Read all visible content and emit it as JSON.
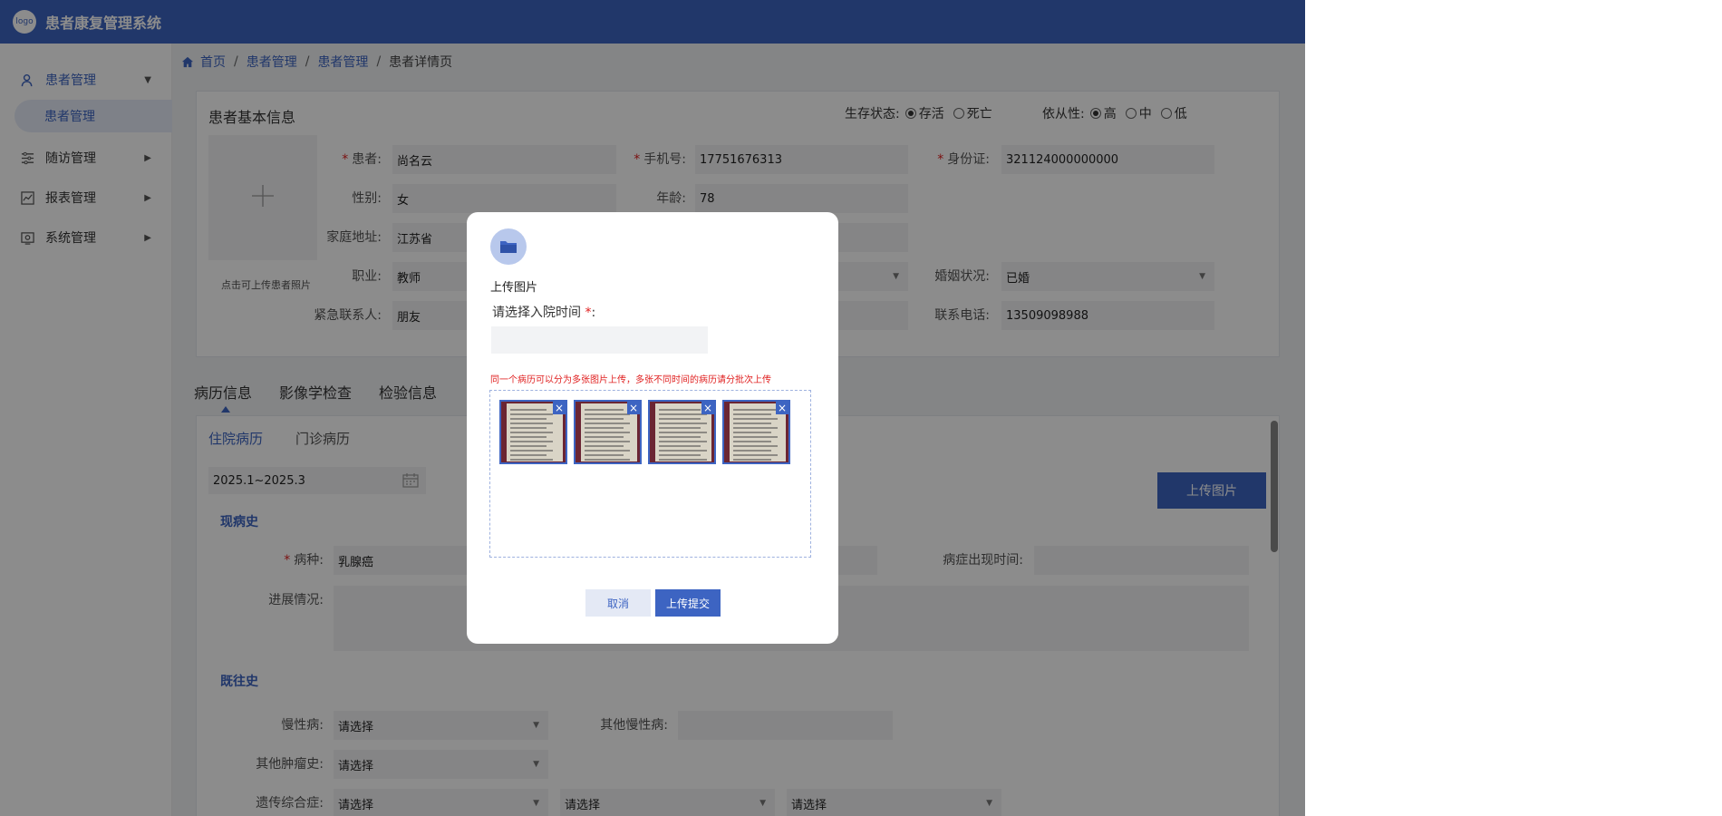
{
  "app": {
    "logo_text": "logo",
    "title": "患者康复管理系统"
  },
  "sidebar": {
    "items": [
      {
        "label": "患者管理"
      },
      {
        "label": "随访管理"
      },
      {
        "label": "报表管理"
      },
      {
        "label": "系统管理"
      }
    ],
    "sub_item": "患者管理"
  },
  "breadcrumb": [
    "首页",
    "患者管理",
    "患者管理",
    "患者详情页"
  ],
  "basic_info": {
    "title": "患者基本信息",
    "survival_label": "生存状态:",
    "survival_options": [
      "存活",
      "死亡"
    ],
    "survival_selected": "存活",
    "compliance_label": "依从性:",
    "compliance_options": [
      "高",
      "中",
      "低"
    ],
    "compliance_selected": "高",
    "photo_hint": "点击可上传患者照片",
    "fields": {
      "patient": {
        "label": "患者:",
        "value": "尚名云"
      },
      "phone": {
        "label": "手机号:",
        "value": "17751676313"
      },
      "id_card": {
        "label": "身份证:",
        "value": "321124000000000"
      },
      "gender": {
        "label": "性别:",
        "value": "女"
      },
      "age": {
        "label": "年龄:",
        "value": "78"
      },
      "address": {
        "label": "家庭地址:",
        "value": "江苏省"
      },
      "job": {
        "label": "职业:",
        "value": "教师"
      },
      "marital": {
        "label": "婚姻状况:",
        "value": "已婚"
      },
      "emergency": {
        "label": "紧急联系人:",
        "value": "朋友"
      },
      "contact_phone": {
        "label": "联系电话:",
        "value": "13509098988"
      }
    }
  },
  "tabs": [
    "病历信息",
    "影像学检查",
    "检验信息"
  ],
  "sub_tabs": [
    "住院病历",
    "门诊病历"
  ],
  "record": {
    "date_range": "2025.1~2025.3",
    "upload_button": "上传图片",
    "present_title": "现病史",
    "disease_label": "病种:",
    "disease_value": "乳腺癌",
    "onset_label": "病症出现时间:",
    "progress_label": "进展情况:",
    "past_title": "既往史",
    "chronic_label": "慢性病:",
    "select_placeholder": "请选择",
    "other_chronic_label": "其他慢性病:",
    "other_tumor_label": "其他肿瘤史:",
    "genetic_label": "遗传综合症:"
  },
  "modal": {
    "title": "上传图片",
    "date_label": "请选择入院时间",
    "note": "同一个病历可以分为多张图片上传，多张不同时间的病历请分批次上传",
    "cancel": "取消",
    "submit": "上传提交",
    "image_count": 4
  }
}
